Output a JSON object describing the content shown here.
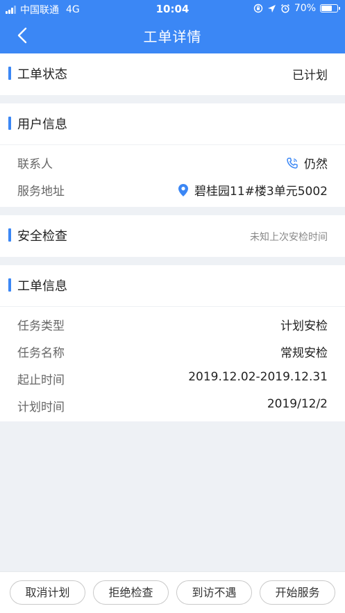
{
  "status_bar": {
    "carrier": "中国联通",
    "network": "4G",
    "time": "10:04",
    "battery": "70%",
    "battery_level": 0.7
  },
  "nav": {
    "title": "工单详情"
  },
  "order_status": {
    "title": "工单状态",
    "value": "已计划"
  },
  "user_info": {
    "title": "用户信息",
    "contact_label": "联系人",
    "contact_value": "仍然",
    "address_label": "服务地址",
    "address_value": "碧桂园11#楼3单元5002"
  },
  "safety_check": {
    "title": "安全检查",
    "hint": "未知上次安检时间"
  },
  "order_info": {
    "title": "工单信息",
    "rows": [
      {
        "label": "任务类型",
        "value": "计划安检"
      },
      {
        "label": "任务名称",
        "value": "常规安检"
      },
      {
        "label": "起止时间",
        "value": "2019.12.02-2019.12.31"
      },
      {
        "label": "计划时间",
        "value": "2019/12/2"
      }
    ]
  },
  "actions": {
    "cancel_plan": "取消计划",
    "refuse_check": "拒绝检查",
    "not_met": "到访不遇",
    "start_service": "开始服务"
  },
  "colors": {
    "accent": "#3b87f5",
    "background": "#eef1f5"
  }
}
